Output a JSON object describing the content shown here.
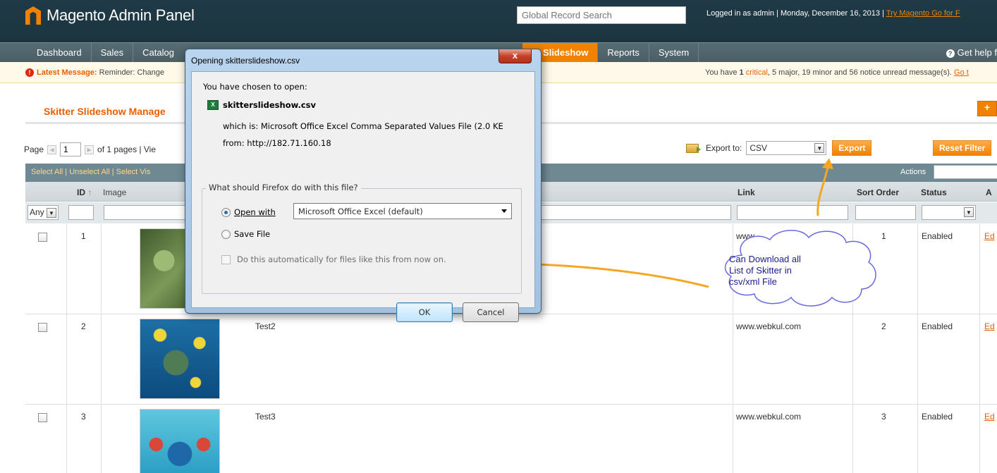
{
  "header": {
    "app_title": "Magento Admin Panel",
    "global_search_placeholder": "Global Record Search",
    "login_info": "Logged in as admin  |  Monday, December 16, 2013  |  ",
    "try_link": "Try Magento Go for F"
  },
  "nav": {
    "items": [
      "Dashboard",
      "Sales",
      "Catalog",
      "Skitter Slideshow",
      "Reports",
      "System"
    ],
    "active_label": "er Slideshow",
    "help": "Get help f"
  },
  "message": {
    "latest_label": "Latest Message:",
    "latest_text": "Reminder: Change",
    "summary_prefix": "You have ",
    "critical_count": "1",
    "critical_label": "critical",
    "rest": ", 5 major, 19 minor and 56 notice unread message(s). ",
    "goto": "Go t"
  },
  "page": {
    "title": "Skitter Slideshow Manage",
    "add_button": "+"
  },
  "pager": {
    "page_label": "Page",
    "page_value": "1",
    "of_pages": "of 1 pages  |  Vie",
    "export_label": "Export to:",
    "export_value": "CSV",
    "export_button": "Export",
    "reset_button": "Reset Filter"
  },
  "massaction": {
    "links": "Select All  |  Unselect All  |  Select Vis",
    "actions_label": "Actions"
  },
  "grid": {
    "headers": {
      "id": "ID",
      "sort_arrow": "↑",
      "image": "Image",
      "link": "Link",
      "sort_order": "Sort Order",
      "status": "Status",
      "action": "A"
    },
    "any_filter": "Any",
    "rows": [
      {
        "id": "1",
        "title": "",
        "link": "www.",
        "sort_order": "1",
        "status": "Enabled",
        "action": "Ed"
      },
      {
        "id": "2",
        "title": "Test2",
        "link": "www.webkul.com",
        "sort_order": "2",
        "status": "Enabled",
        "action": "Ed"
      },
      {
        "id": "3",
        "title": "Test3",
        "link": "www.webkul.com",
        "sort_order": "3",
        "status": "Enabled",
        "action": "Ed"
      }
    ]
  },
  "dialog": {
    "title": "Opening skitterslideshow.csv",
    "close": "x",
    "chosen": "You have chosen to open:",
    "filename": "skitterslideshow.csv",
    "which_is": "which is:  Microsoft Office Excel Comma Separated Values File (2.0 KE",
    "from": "from:  http://182.71.160.18",
    "question": "What should Firefox do with this file?",
    "open_with": "Open with",
    "open_with_app": "Microsoft Office Excel (default)",
    "save_file": "Save File",
    "auto": "Do this automatically for files like this from now on.",
    "ok": "OK",
    "cancel": "Cancel",
    "file_icon_label": "X"
  },
  "callout": {
    "text": "Can Download all\nList of Skitter in\ncsv/xml File",
    "color": "#1b1b8e"
  },
  "colors": {
    "accent": "#eb5e00",
    "header_bg": "#1f3a46",
    "nav_bg": "#566c73"
  }
}
